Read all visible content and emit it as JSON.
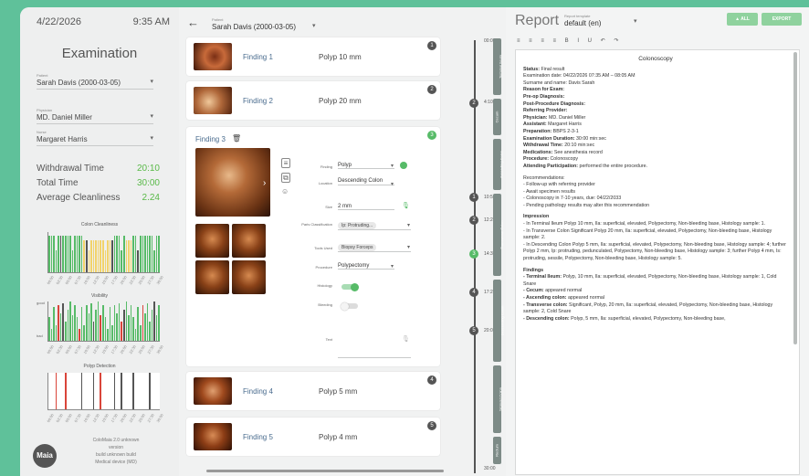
{
  "left": {
    "date": "4/22/2026",
    "time": "9:35 AM",
    "title": "Examination",
    "patient": {
      "label": "Patient",
      "value": "Sarah Davis (2000-03-05)"
    },
    "physician": {
      "label": "Physician",
      "value": "MD. Daniel Miller"
    },
    "nurse": {
      "label": "Nurse",
      "value": "Margaret Harris"
    },
    "stats": [
      {
        "label": "Withdrawal Time",
        "value": "20:10"
      },
      {
        "label": "Total Time",
        "value": "30:00"
      },
      {
        "label": "Average Cleanliness",
        "value": "2.24"
      }
    ],
    "charts": {
      "cleanliness_title": "Colon Cleanliness",
      "visibility_title": "Visibility",
      "visibility_good": "good",
      "visibility_bad": "bad",
      "polyp_title": "Polyp Detection"
    },
    "x_ticks": [
      "00:00",
      "02:30",
      "05:00",
      "07:30",
      "10:00",
      "12:30",
      "15:00",
      "17:30",
      "20:00",
      "22:30",
      "25:00",
      "27:30",
      "30:00"
    ],
    "logo": "Maia",
    "build": [
      "ColoMaia 2.0 unknown",
      "version",
      "build unknown build",
      "Medical device (MD)"
    ]
  },
  "middle": {
    "patient_label": "Patient",
    "patient_value": "Sarah Davis (2000-03-05)",
    "findings": [
      {
        "num": "1",
        "title": "Finding 1",
        "desc": "Polyp 10 mm"
      },
      {
        "num": "2",
        "title": "Finding 2",
        "desc": "Polyp 20 mm"
      },
      {
        "num": "3",
        "title": "Finding 3"
      },
      {
        "num": "4",
        "title": "Finding 4",
        "desc": "Polyp 5 mm"
      },
      {
        "num": "5",
        "title": "Finding 5",
        "desc": "Polyp 4 mm"
      }
    ],
    "props": {
      "finding_label": "Finding",
      "finding_value": "Polyp",
      "location_label": "Location",
      "location_value": "Descending Colon",
      "size_label": "Size",
      "size_value": "2 mm",
      "paris_label": "Paris Classification",
      "paris_value": "Ip: Protruding...",
      "tools_label": "Tools Used",
      "tools_value": "Biopsy Forceps",
      "procedure_label": "Procedure",
      "procedure_value": "Polypectomy",
      "histology_label": "Histology",
      "bleeding_label": "Bleeding",
      "text_label": "Text"
    },
    "timeline": [
      {
        "time": "00:00",
        "node": ""
      },
      {
        "time": "4:10",
        "node": "2"
      },
      {
        "time": "10:50",
        "node": "1"
      },
      {
        "time": "12:21",
        "node": "2"
      },
      {
        "time": "14:38",
        "node": "3"
      },
      {
        "time": "17:23",
        "node": "4"
      },
      {
        "time": "20:03",
        "node": "5"
      },
      {
        "time": "30:00",
        "node": ""
      }
    ],
    "segments": [
      "Terminal Ileum",
      "Cecum",
      "Ascending Colon",
      "Transverse Colon",
      "Descending Colon",
      "Sigmoid Colon",
      "Rectum"
    ]
  },
  "report": {
    "title": "Report",
    "template_label": "Report template",
    "template_value": "default (en)",
    "btn_all": "▲ ALL",
    "btn_export": "EXPORT",
    "toolbar": "≡ ≡ ≡ ≡ B I U ↶ ↷",
    "heading": "Colonoscopy",
    "lines": [
      {
        "b": "Status: ",
        "t": "Final result"
      },
      {
        "b": "",
        "t": "Examination date: 04/22/2026 07:35 AM – 08:05 AM"
      },
      {
        "b": "",
        "t": "Surname and name: Davis Sarah"
      },
      {
        "b": "Reason for Exam:",
        "t": ""
      },
      {
        "b": "Pre-op Diagnosis:",
        "t": ""
      },
      {
        "b": "Post-Procedure Diagnosis:",
        "t": ""
      },
      {
        "b": "Referring Provider:",
        "t": ""
      },
      {
        "b": "   Physician: ",
        "t": "MD. Daniel Miller"
      },
      {
        "b": "   Assistant: ",
        "t": "Margaret Harris"
      },
      {
        "b": "Preparation: ",
        "t": "BBPS 2-3-1"
      },
      {
        "b": "Examination Duration: ",
        "t": "30:00 min:sec"
      },
      {
        "b": "Withdrawal Time: ",
        "t": "20:10 min:sec"
      },
      {
        "b": "Medications: ",
        "t": "See anesthesia record"
      },
      {
        "b": "Procedure: ",
        "t": "Colonoscopy"
      },
      {
        "b": "Attending Participation: ",
        "t": "performed the entire procedure."
      }
    ],
    "recommend_title": "Recommendations:",
    "recommend": [
      "- Follow-up with referring provider",
      "- Await specimen results",
      "- Colonoscopy in 7-10 years, due: 04/22/2033",
      "- Pending pathology results may alter this recommendation"
    ],
    "impression_title": "Impression",
    "impression": [
      "- In Terminal Ileum Polyp 10 mm, Ila: superficial, elevated, Polypectomy, Non-bleeding base, Histology sample: 1.",
      "- In Transverse Colon Significant Polyp 20 mm, Ila: superficial, elevated, Polypectomy, Non-bleeding base, Histology sample: 2.",
      "- In Descending Colon Polyp 5 mm, Ila: superficial, elevated, Polypectomy, Non-bleeding base, Histology sample: 4; further Polyp 2 mm, Ip: protruding, pedunculated, Polypectomy, Non-bleeding base, Histology sample: 3; further Polyp 4 mm, Is: protruding, sessile, Polypectomy, Non-bleeding base, Histology sample: 5."
    ],
    "findings_title": "Findings",
    "findings": [
      {
        "b": "- Terminal Ileum: ",
        "t": "Polyp, 10 mm, Ila: superficial, elevated, Polypectomy, Non-bleeding base, Histology sample: 1, Cold Snare"
      },
      {
        "b": "- Cecum: ",
        "t": "appeared normal"
      },
      {
        "b": "- Ascending colon: ",
        "t": "appeared normal"
      },
      {
        "b": "- Transverse colon: ",
        "t": "Significant, Polyp, 20 mm, Ila: superficial, elevated, Polypectomy, Non-bleeding base, Histology sample: 2, Cold Snare"
      },
      {
        "b": "- Descending colon: ",
        "t": "Polyp, 5 mm, Ila: superficial, elevated, Polypectomy, Non-bleeding base,"
      }
    ]
  },
  "colors": {
    "accent": "#5fc19a",
    "green": "#57bb68",
    "yellow": "#f2d36b",
    "red": "#d9453a"
  }
}
